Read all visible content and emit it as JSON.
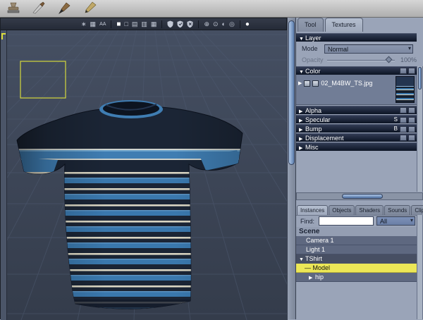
{
  "top_toolbar": {
    "tools": [
      {
        "name": "stamp-tool"
      },
      {
        "name": "knife-tool"
      },
      {
        "name": "brush-tool"
      },
      {
        "name": "pen-tool"
      }
    ]
  },
  "viewport": {
    "toolbar_icons": [
      {
        "name": "asterisk-icon",
        "glyph": "∗"
      },
      {
        "name": "grid-icon",
        "glyph": "▦"
      },
      {
        "name": "antialias-icon",
        "glyph": "AA"
      },
      {
        "name": "display-solid-icon",
        "glyph": "■"
      },
      {
        "name": "display-wire-icon",
        "glyph": "□"
      },
      {
        "name": "display-lines-icon",
        "glyph": "▤"
      },
      {
        "name": "display-vlines-icon",
        "glyph": "▥"
      },
      {
        "name": "display-grid-icon",
        "glyph": "▦"
      },
      {
        "name": "orbit-plus-icon",
        "glyph": "⊕"
      },
      {
        "name": "orbit-dot-icon",
        "glyph": "⊙"
      },
      {
        "name": "orbit-half-icon",
        "glyph": "◐"
      },
      {
        "name": "orbit-ring-icon",
        "glyph": "◎"
      },
      {
        "name": "light-icon",
        "glyph": "●"
      }
    ]
  },
  "right_panel": {
    "tabs": {
      "tool": "Tool",
      "textures": "Textures"
    },
    "layer": {
      "tri": "▼",
      "title": "Layer",
      "mode_label": "Mode",
      "mode_value": "Normal",
      "mode_arrow": "▾",
      "opacity_label": "Opacity",
      "opacity_value": "100%"
    },
    "channels": {
      "color": {
        "tri": "▼",
        "label": "Color",
        "texture_tri": "▶",
        "texture_name": "02_M4BW_TS.jpg"
      },
      "alpha": {
        "tri": "▶",
        "label": "Alpha"
      },
      "specular": {
        "tri": "▶",
        "label": "Specular",
        "badge": "S"
      },
      "bump": {
        "tri": "▶",
        "label": "Bump",
        "badge": "B"
      },
      "displacement": {
        "tri": "▶",
        "label": "Displacement"
      },
      "misc": {
        "tri": "▶",
        "label": "Misc"
      }
    }
  },
  "bottom_panel": {
    "tabs": [
      "Instances",
      "Objects",
      "Shaders",
      "Sounds",
      "Clips"
    ],
    "find_label": "Find:",
    "filter_value": "All",
    "filter_arrow": "▾",
    "scene_title": "Scene",
    "items": {
      "camera": {
        "label": "Camera 1"
      },
      "light": {
        "label": "Light 1"
      },
      "tshirt": {
        "tri": "▼",
        "label": "TShirt"
      },
      "model": {
        "dash": "—",
        "label": "Model"
      },
      "hip": {
        "tri": "▶",
        "label": "hip"
      }
    }
  },
  "colors": {
    "accent_blue": "#3f7db2",
    "stripe_cream": "#d9d5c2",
    "shirt_navy": "#1b2535",
    "selection_yellow": "#ece757",
    "panel": "#9aa4b8"
  }
}
